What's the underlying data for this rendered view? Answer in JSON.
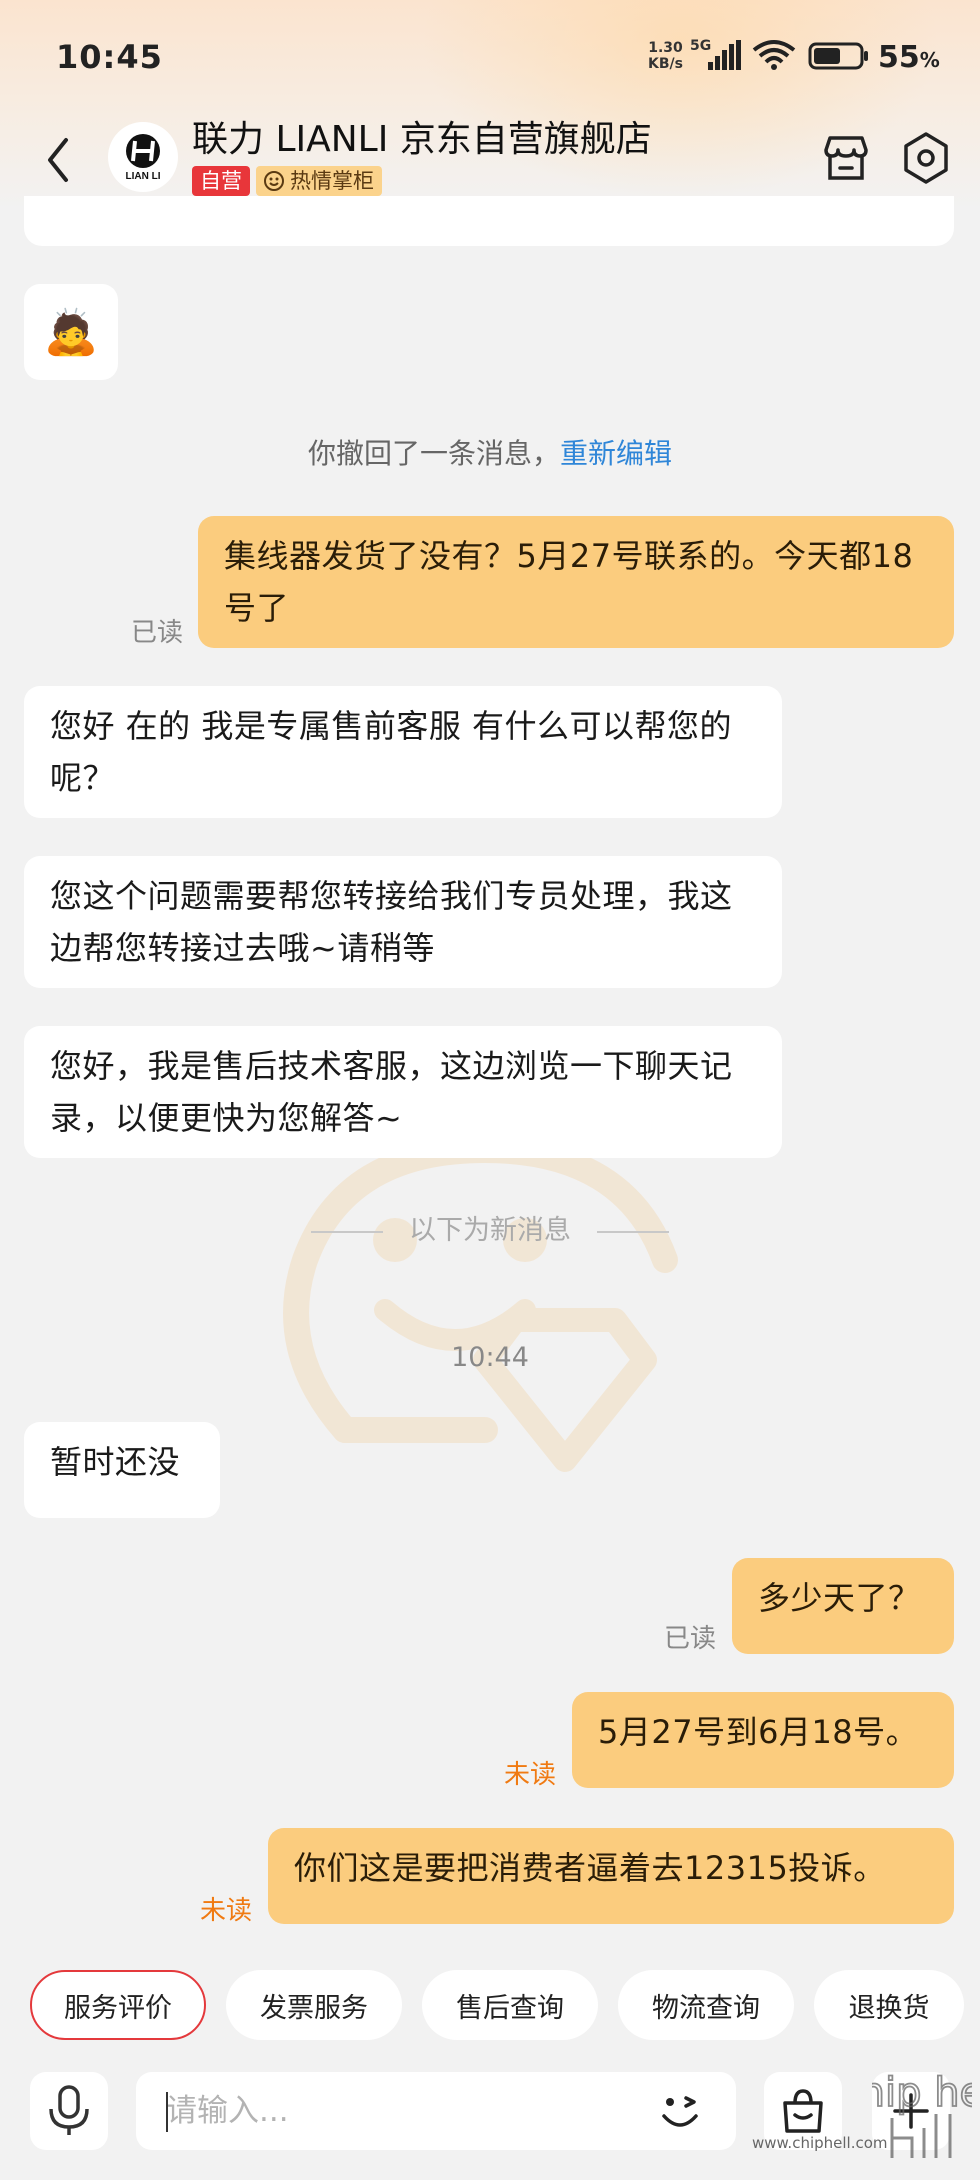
{
  "status_bar": {
    "time": "10:45",
    "network_speed": "1.30",
    "network_unit": "KB/s",
    "network_type": "5G",
    "battery_percent": "55",
    "battery_symbol": "%"
  },
  "header": {
    "store_name": "联力 LIANLI 京东自营旗舰店",
    "logo_text": "LIAN LI",
    "badge_self_operated": "自营",
    "badge_hot": "热情掌柜"
  },
  "chat": {
    "emoji": "🙇",
    "recall_notice": "你撤回了一条消息，",
    "recall_edit_link": "重新编辑",
    "messages": [
      {
        "side": "out",
        "text": "集线器发货了没有？5月27号联系的。今天都18号了",
        "status": "已读"
      },
      {
        "side": "in",
        "text": "您好 在的 我是专属售前客服 有什么可以帮您的呢？"
      },
      {
        "side": "in",
        "text": "您这个问题需要帮您转接给我们专员处理，我这边帮您转接过去哦~请稍等"
      },
      {
        "side": "in",
        "text": "您好，我是售后技术客服，这边浏览一下聊天记录，以便更快为您解答~"
      },
      {
        "side": "in",
        "text": "暂时还没"
      },
      {
        "side": "out",
        "text": "多少天了？",
        "status": "已读"
      },
      {
        "side": "out",
        "text": "5月27号到6月18号。",
        "status": "未读"
      },
      {
        "side": "out",
        "text": "你们这是要把消费者逼着去12315投诉。",
        "status": "未读"
      }
    ],
    "new_message_divider": "以下为新消息",
    "timestamp": "10:44"
  },
  "quick_actions": [
    "服务评价",
    "发票服务",
    "售后查询",
    "物流查询",
    "退换货"
  ],
  "input": {
    "placeholder": "请输入..."
  },
  "watermark": {
    "site": "www.chiphell.com",
    "logo": "chip hell"
  },
  "colors": {
    "outgoing_bubble": "#fbcc7e",
    "incoming_bubble": "#ffffff",
    "link": "#2f86d8",
    "unread": "#f07a12",
    "badge_red": "#e8363a"
  },
  "icons": [
    "back-arrow-icon",
    "store-icon",
    "settings-hexagon-icon",
    "microphone-icon",
    "wink-emoji-icon",
    "shopping-bag-icon"
  ]
}
